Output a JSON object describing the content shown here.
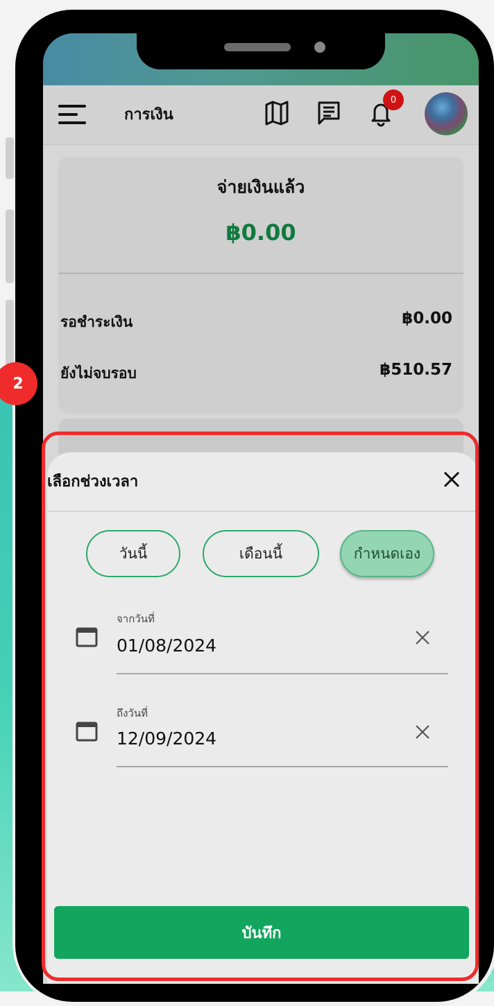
{
  "step_marker": "2",
  "header": {
    "title": "การเงิน",
    "notification_count": "0",
    "icons": [
      "menu-icon",
      "map-icon",
      "message-icon",
      "bell-icon",
      "avatar"
    ]
  },
  "summary": {
    "paid_title": "จ่ายเงินแล้ว",
    "paid_amount": "฿0.00",
    "rows": [
      {
        "label": "รอชำระเงิน",
        "value": "฿0.00"
      },
      {
        "label": "ยังไม่จบรอบ",
        "value": "฿510.57"
      }
    ]
  },
  "sheet": {
    "title": "เลือกช่วงเวลา",
    "chips": [
      {
        "label": "วันนี้",
        "active": false
      },
      {
        "label": "เดือนนี้",
        "active": false
      },
      {
        "label": "กำหนดเอง",
        "active": true
      }
    ],
    "from": {
      "caption": "จากวันที่",
      "value": "01/08/2024"
    },
    "to": {
      "caption": "ถึงวันที่",
      "value": "12/09/2024"
    },
    "save_label": "บันทึก"
  },
  "colors": {
    "accent_green": "#12a55d",
    "amount_green": "#0f7a3e",
    "badge_red": "#cf1313",
    "highlight_red": "#ef2b2b",
    "chip_active": "#94d5b3"
  }
}
